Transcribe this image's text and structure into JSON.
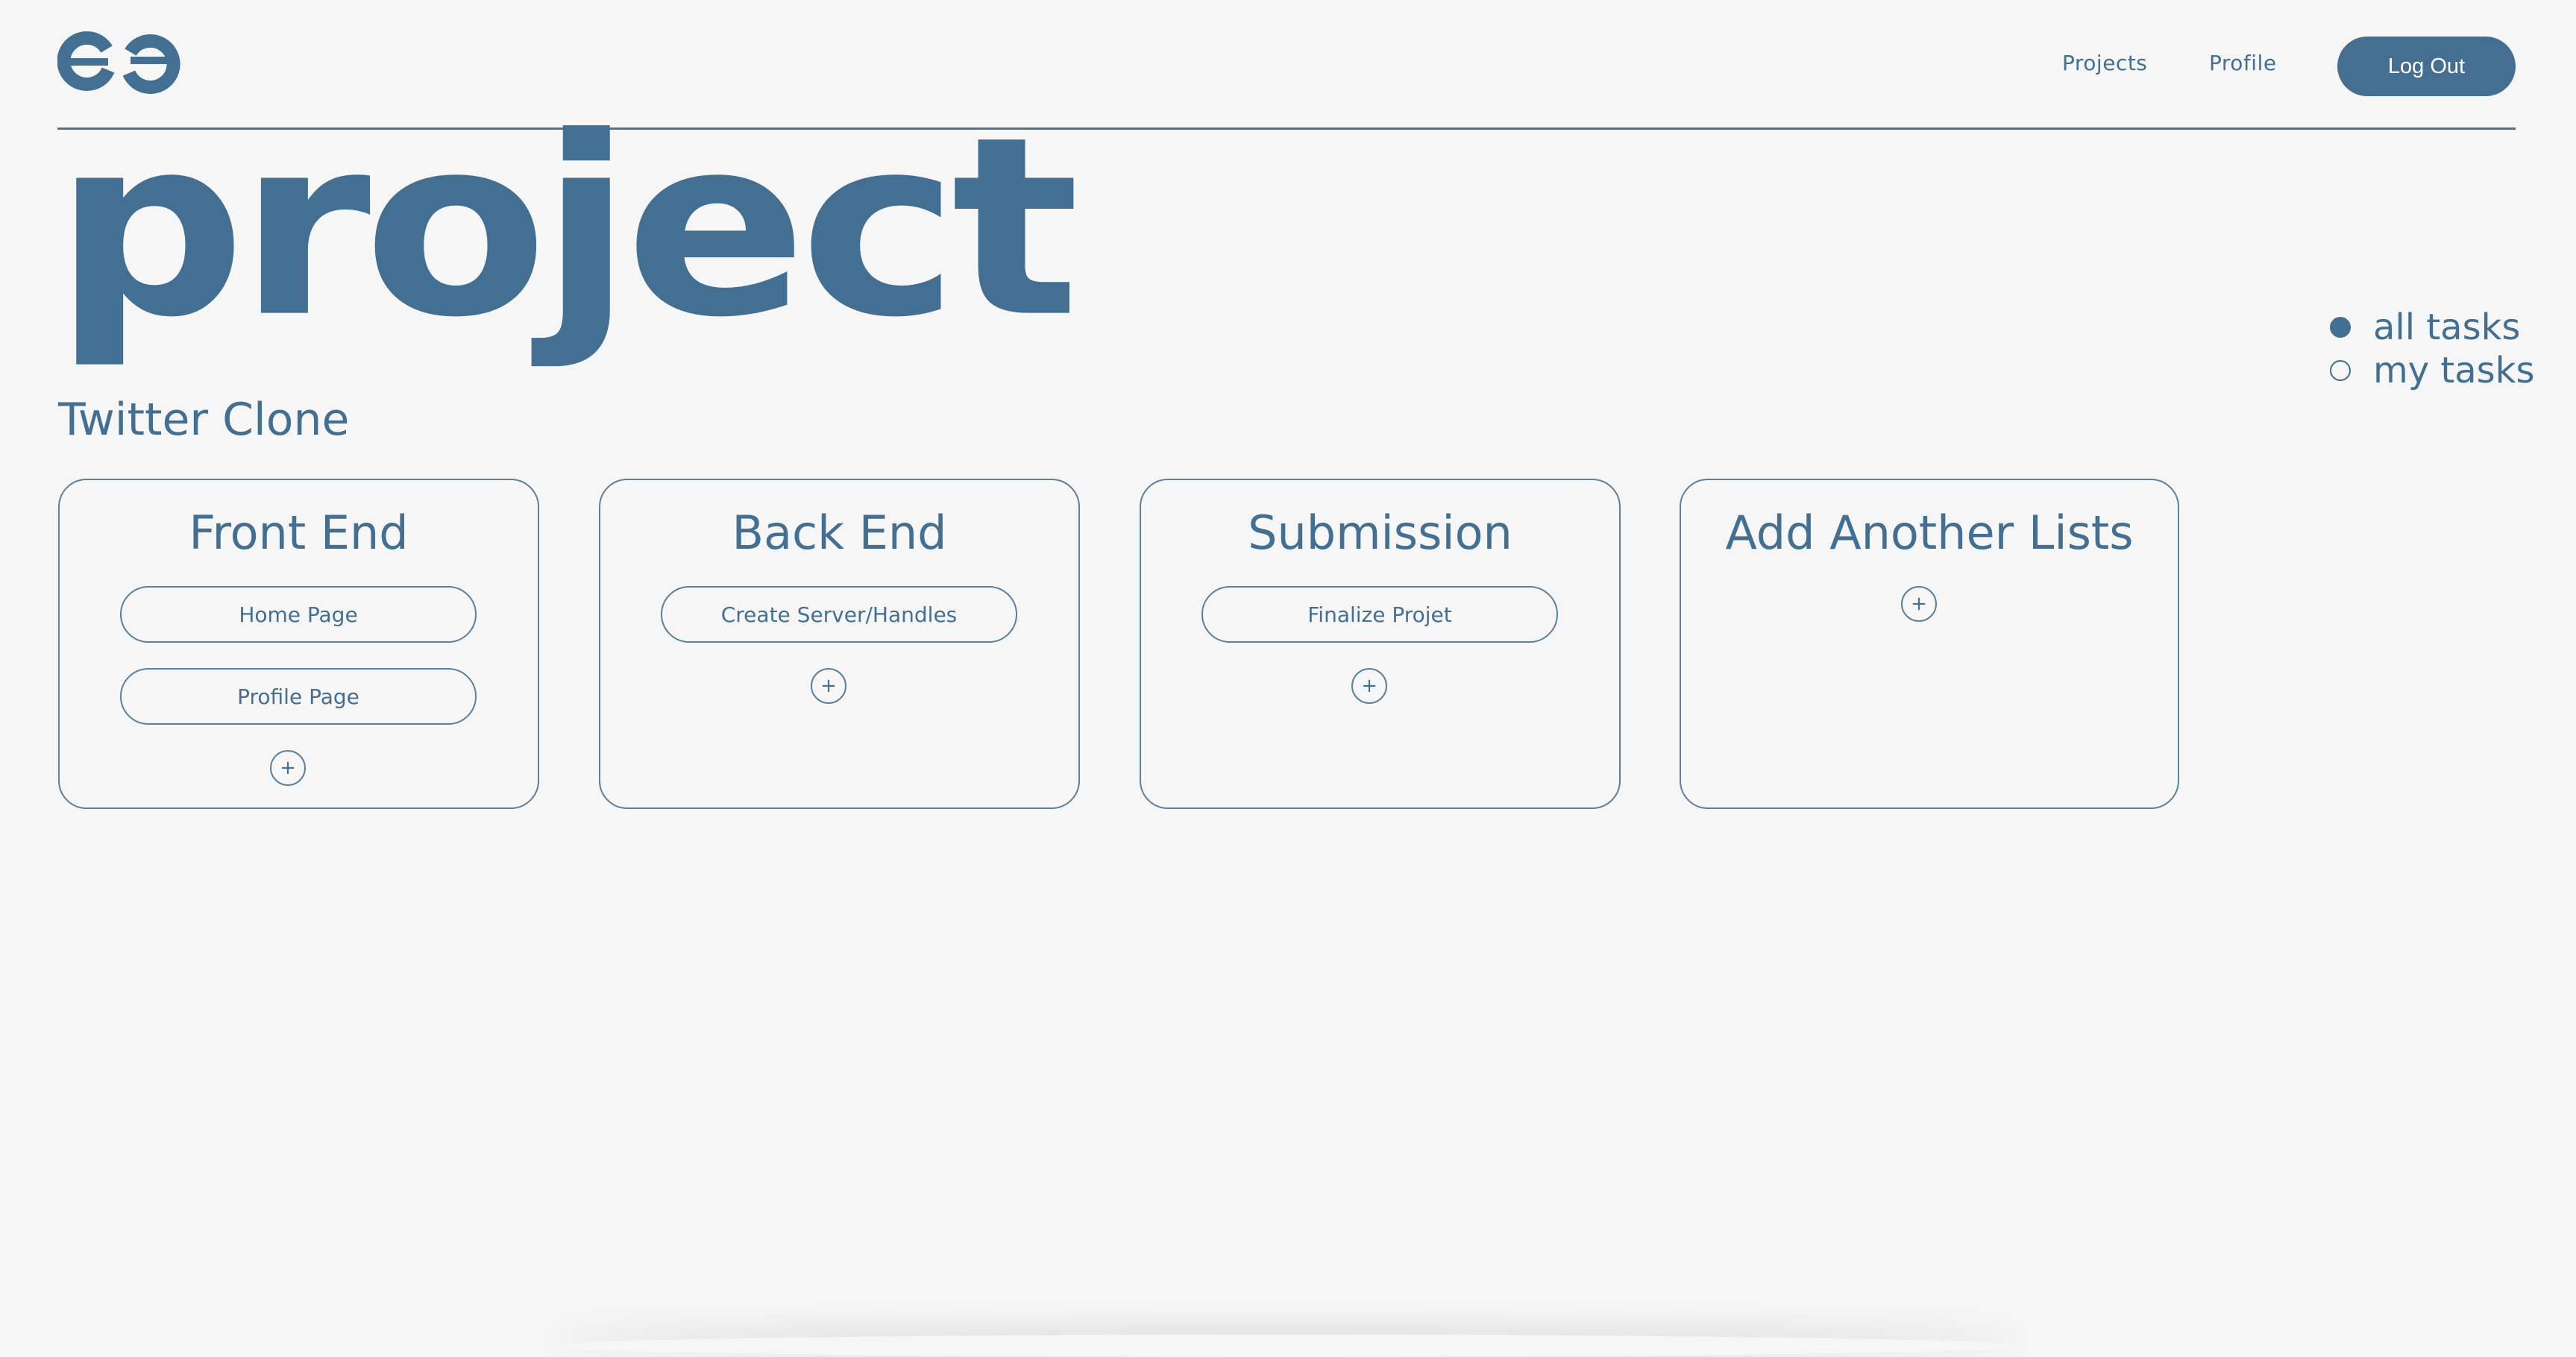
{
  "colors": {
    "background": "#f6f6f6",
    "primary": "#446f91",
    "button_text": "#ffffff"
  },
  "header": {
    "logo_icon": "ee-logo-icon",
    "nav": {
      "projects": "Projects",
      "profile": "Profile"
    },
    "logout_label": "Log Out"
  },
  "page": {
    "title": "project",
    "project_name": "Twitter Clone"
  },
  "filter": {
    "options": [
      {
        "label": "all tasks",
        "checked": true
      },
      {
        "label": "my tasks",
        "checked": false
      }
    ]
  },
  "lists": [
    {
      "title": "Front End",
      "tasks": [
        "Home Page",
        "Profile Page"
      ],
      "add_icon": "plus-icon"
    },
    {
      "title": "Back End",
      "tasks": [
        "Create Server/Handles"
      ],
      "add_icon": "plus-icon"
    },
    {
      "title": "Submission",
      "tasks": [
        "Finalize Projet"
      ],
      "add_icon": "plus-icon"
    },
    {
      "title": "Add Another Lists",
      "tasks": [],
      "add_icon": "plus-icon"
    }
  ]
}
